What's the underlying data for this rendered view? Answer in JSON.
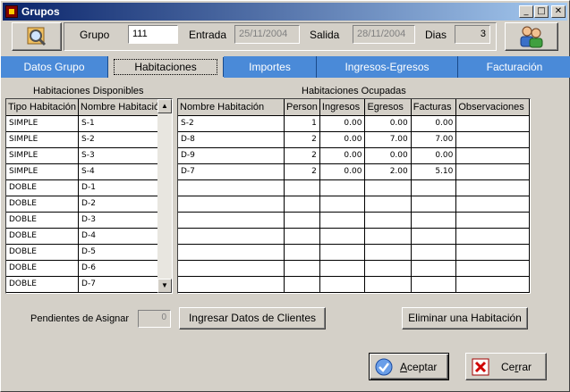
{
  "window": {
    "title": "Grupos",
    "controls": {
      "minimize": "_",
      "maximize": "□",
      "close": "✕"
    }
  },
  "header": {
    "grupo_label": "Grupo",
    "grupo_value": "111",
    "entrada_label": "Entrada",
    "entrada_value": "25/11/2004",
    "salida_label": "Salida",
    "salida_value": "28/11/2004",
    "dias_label": "Dias",
    "dias_value": "3",
    "left_icon": "magnifier-icon",
    "right_icon": "users-icon"
  },
  "tabs": [
    {
      "label": "Datos Grupo",
      "active": false
    },
    {
      "label": "Habitaciones",
      "active": true
    },
    {
      "label": "Importes",
      "active": false
    },
    {
      "label": "Ingresos-Egresos",
      "active": false
    },
    {
      "label": "Facturación",
      "active": false
    }
  ],
  "disponibles": {
    "caption": "Habitaciones Disponibles",
    "columns": [
      "Tipo Habitación",
      "Nombre Habitación"
    ],
    "rows": [
      [
        "SIMPLE",
        "S-1"
      ],
      [
        "SIMPLE",
        "S-2"
      ],
      [
        "SIMPLE",
        "S-3"
      ],
      [
        "SIMPLE",
        "S-4"
      ],
      [
        "DOBLE",
        "D-1"
      ],
      [
        "DOBLE",
        "D-2"
      ],
      [
        "DOBLE",
        "D-3"
      ],
      [
        "DOBLE",
        "D-4"
      ],
      [
        "DOBLE",
        "D-5"
      ],
      [
        "DOBLE",
        "D-6"
      ],
      [
        "DOBLE",
        "D-7"
      ]
    ],
    "scroll_up": "▲",
    "scroll_down": "▼"
  },
  "ocupadas": {
    "caption": "Habitaciones Ocupadas",
    "columns": [
      "Nombre Habitación",
      "Person",
      "Ingresos",
      "Egresos",
      "Facturas",
      "Observaciones"
    ],
    "rows": [
      [
        "S-2",
        "1",
        "0.00",
        "0.00",
        "0.00",
        ""
      ],
      [
        "D-8",
        "2",
        "0.00",
        "7.00",
        "7.00",
        ""
      ],
      [
        "D-9",
        "2",
        "0.00",
        "0.00",
        "0.00",
        ""
      ],
      [
        "D-7",
        "2",
        "0.00",
        "2.00",
        "5.10",
        ""
      ]
    ]
  },
  "pendientes": {
    "label": "Pendientes de Asignar",
    "value": "0"
  },
  "buttons": {
    "ingresar": "Ingresar Datos de Clientes",
    "eliminar": "Eliminar una Habitación",
    "aceptar_first": "A",
    "aceptar_rest": "ceptar",
    "cerrar_first": "Ce",
    "cerrar_u": "r",
    "cerrar_rest": "rar"
  }
}
